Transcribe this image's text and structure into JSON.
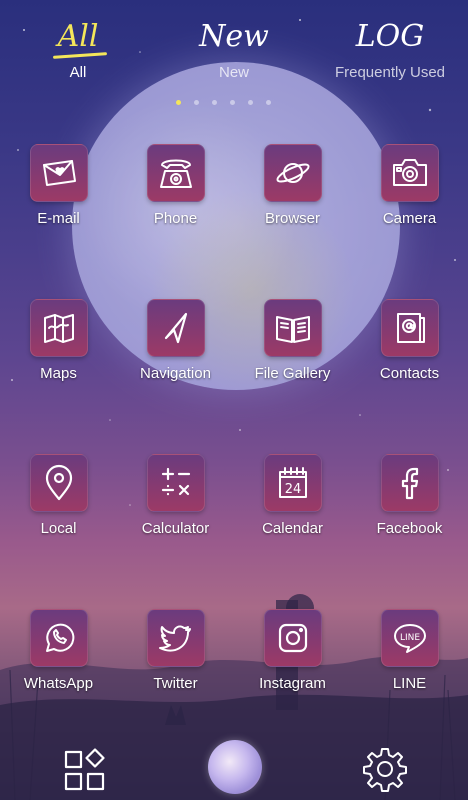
{
  "tabs": [
    {
      "script": "All",
      "label": "All",
      "active": true
    },
    {
      "script": "New",
      "label": "New",
      "active": false
    },
    {
      "script": "LOG",
      "label": "Frequently Used",
      "active": false
    }
  ],
  "page_indicator": {
    "count": 6,
    "current": 1
  },
  "apps": [
    {
      "label": "E-mail",
      "icon": "envelope-heart-icon"
    },
    {
      "label": "Phone",
      "icon": "rotary-phone-icon"
    },
    {
      "label": "Browser",
      "icon": "planet-icon"
    },
    {
      "label": "Camera",
      "icon": "camera-icon"
    },
    {
      "label": "Maps",
      "icon": "map-icon"
    },
    {
      "label": "Navigation",
      "icon": "navigation-arrow-icon"
    },
    {
      "label": "File Gallery",
      "icon": "open-book-icon"
    },
    {
      "label": "Contacts",
      "icon": "address-book-icon"
    },
    {
      "label": "Local",
      "icon": "location-pin-icon"
    },
    {
      "label": "Calculator",
      "icon": "calculator-icon"
    },
    {
      "label": "Calendar",
      "icon": "calendar-icon"
    },
    {
      "label": "Facebook",
      "icon": "facebook-icon"
    },
    {
      "label": "WhatsApp",
      "icon": "whatsapp-icon"
    },
    {
      "label": "Twitter",
      "icon": "bird-icon"
    },
    {
      "label": "Instagram",
      "icon": "instagram-icon"
    },
    {
      "label": "LINE",
      "icon": "line-bubble-icon"
    }
  ],
  "calendar_day": "24",
  "dock": {
    "left_icon": "app-drawer-grid-icon",
    "center_icon": "moon-theme-icon",
    "right_icon": "settings-gear-icon"
  },
  "colors": {
    "accent": "#f4e65a",
    "tile_top": "#6b3b7e",
    "tile_bottom": "#9c3a66",
    "sky_top": "#2a2f7d",
    "sky_bottom": "#a86a88"
  }
}
